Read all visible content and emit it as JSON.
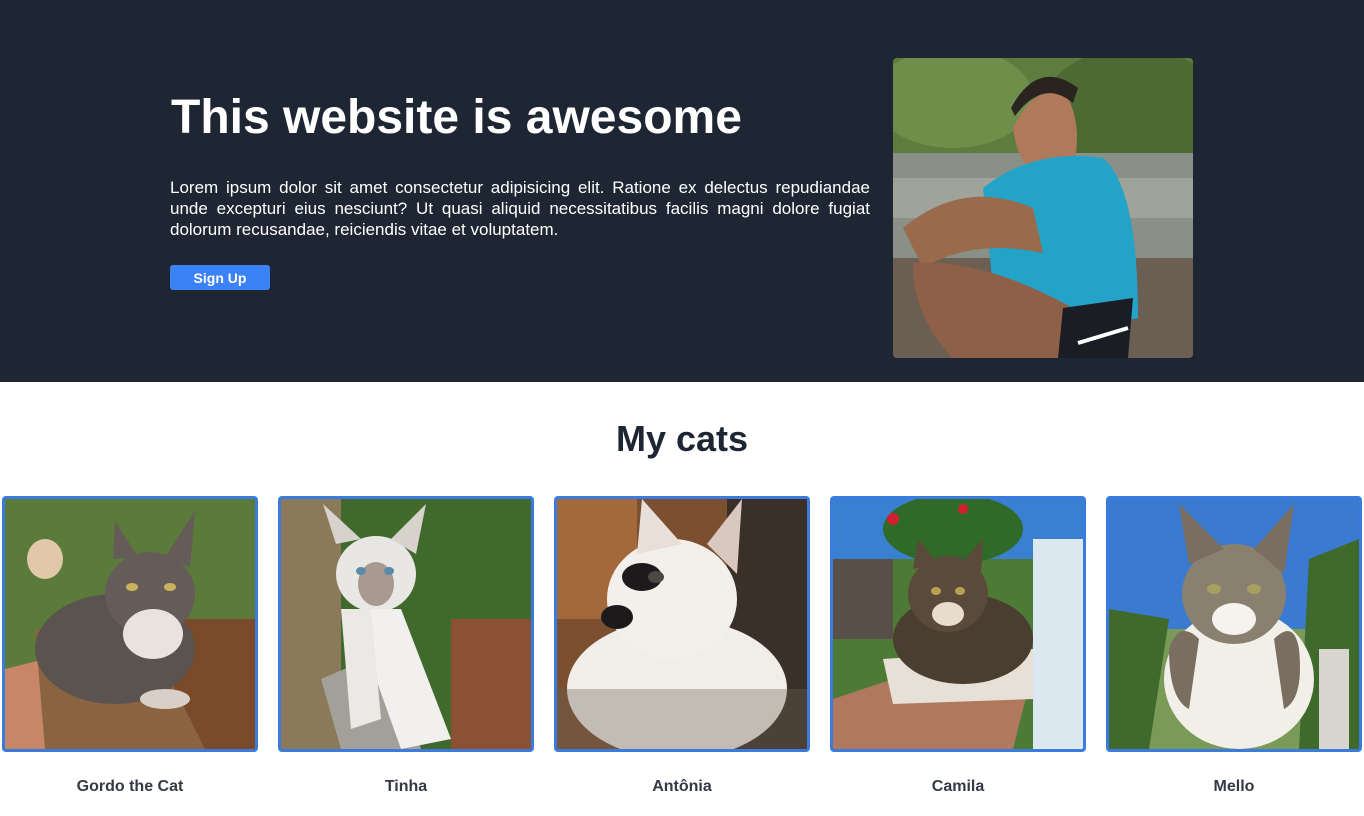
{
  "hero": {
    "title": "This website is awesome",
    "text": "Lorem ipsum dolor sit amet consectetur adipisicing elit. Ratione ex delectus repudiandae unde excepturi eius nesciunt? Ut quasi aliquid necessitatibus facilis magni dolore fugiat dolorum recusandae, reiciendis vitae et voluptatem.",
    "signup_label": "Sign Up",
    "photo": "portrait-photo"
  },
  "cats": {
    "title": "My cats",
    "items": [
      {
        "name": "Gordo the Cat",
        "photo": "cat-photo"
      },
      {
        "name": "Tinha",
        "photo": "cat-photo"
      },
      {
        "name": "Antônia",
        "photo": "cat-photo"
      },
      {
        "name": "Camila",
        "photo": "cat-photo"
      },
      {
        "name": "Mello",
        "photo": "cat-photo"
      }
    ]
  },
  "colors": {
    "hero_bg": "#1e2533",
    "accent": "#3b82f6",
    "card_border": "#3b7be0"
  }
}
